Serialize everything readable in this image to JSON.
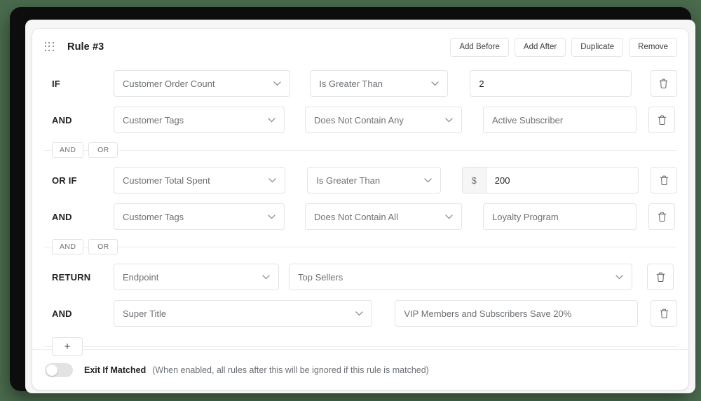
{
  "header": {
    "drag_handle_icon": "drag-dots-icon",
    "title": "Rule #3",
    "actions": [
      {
        "label": "Add Before"
      },
      {
        "label": "Add After"
      },
      {
        "label": "Duplicate"
      },
      {
        "label": "Remove"
      }
    ]
  },
  "rows": [
    {
      "label": "IF",
      "field": "Customer Order Count",
      "operator": "Is Greater Than",
      "value": "2",
      "prefix": null,
      "delete_icon": "trash-icon"
    },
    {
      "label": "AND",
      "field": "Customer Tags",
      "operator": "Does Not Contain Any",
      "value": "Active Subscriber",
      "prefix": null,
      "delete_icon": "trash-icon"
    },
    {
      "label": "OR IF",
      "field": "Customer Total Spent",
      "operator": "Is Greater Than",
      "value": "200",
      "prefix": "$",
      "delete_icon": "trash-icon"
    },
    {
      "label": "AND",
      "field": "Customer Tags",
      "operator": "Does Not Contain All",
      "value": "Loyalty Program",
      "prefix": null,
      "delete_icon": "trash-icon"
    },
    {
      "label": "RETURN",
      "field": "Endpoint",
      "operator": "Top Sellers",
      "value": null,
      "prefix": null,
      "delete_icon": "trash-icon"
    },
    {
      "label": "AND",
      "field": "Super Title",
      "operator": null,
      "value": "VIP Members and Subscribers Save 20%",
      "prefix": null,
      "delete_icon": "trash-icon"
    }
  ],
  "connectors": {
    "and_label": "AND",
    "or_label": "OR"
  },
  "add_row": {
    "label": "+"
  },
  "footer": {
    "toggle_state": "off",
    "label": "Exit If Matched",
    "hint": "(When enabled, all rules after this will be ignored if this rule is matched)"
  },
  "colors": {
    "page_background": "#4a6b4d",
    "bezel": "#0d0d0d",
    "viewport": "#f6f6f7",
    "card": "#ffffff",
    "border": "#e1e3e5",
    "text_strong": "#202223",
    "text_muted": "#6d7175"
  }
}
